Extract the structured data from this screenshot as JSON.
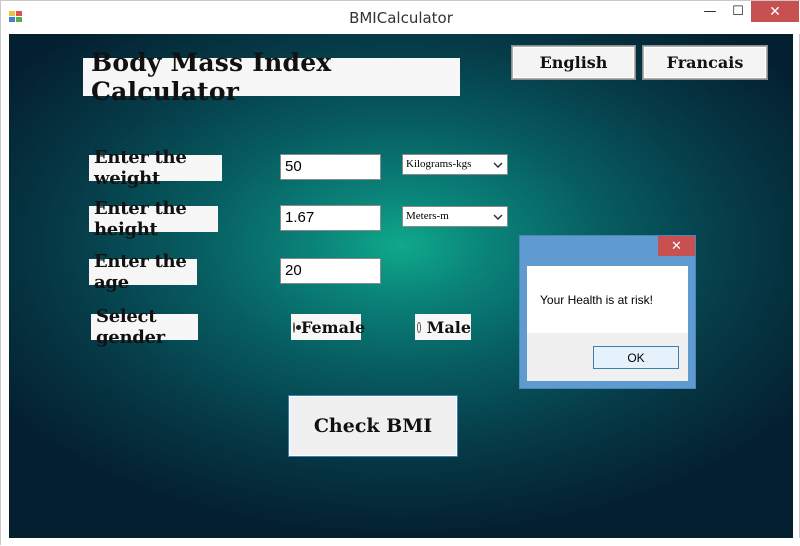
{
  "window": {
    "title": "BMICalculator",
    "controls": {
      "minimize": "—",
      "maximize": "☐",
      "close": "✕"
    }
  },
  "app": {
    "title": "Body Mass Index Calculator",
    "languages": {
      "english": "English",
      "french": "Francais"
    },
    "weight": {
      "label": "Enter the weight",
      "value": "50",
      "unit": "Kilograms-kgs"
    },
    "height": {
      "label": "Enter the height",
      "value": "1.67",
      "unit": "Meters-m"
    },
    "age": {
      "label": "Enter the age",
      "value": "20"
    },
    "gender": {
      "label": "Select gender",
      "options": [
        {
          "label": "Female",
          "selected": true
        },
        {
          "label": "Male",
          "selected": false
        }
      ]
    },
    "check_button": "Check BMI"
  },
  "message_box": {
    "text": "Your Health is at risk!",
    "ok_label": "OK",
    "close": "✕"
  },
  "colors": {
    "background_center": "#0fa98b",
    "background_edge": "#041f2f",
    "close_red": "#c75050",
    "msgbox_frame": "#5f9bd1"
  }
}
